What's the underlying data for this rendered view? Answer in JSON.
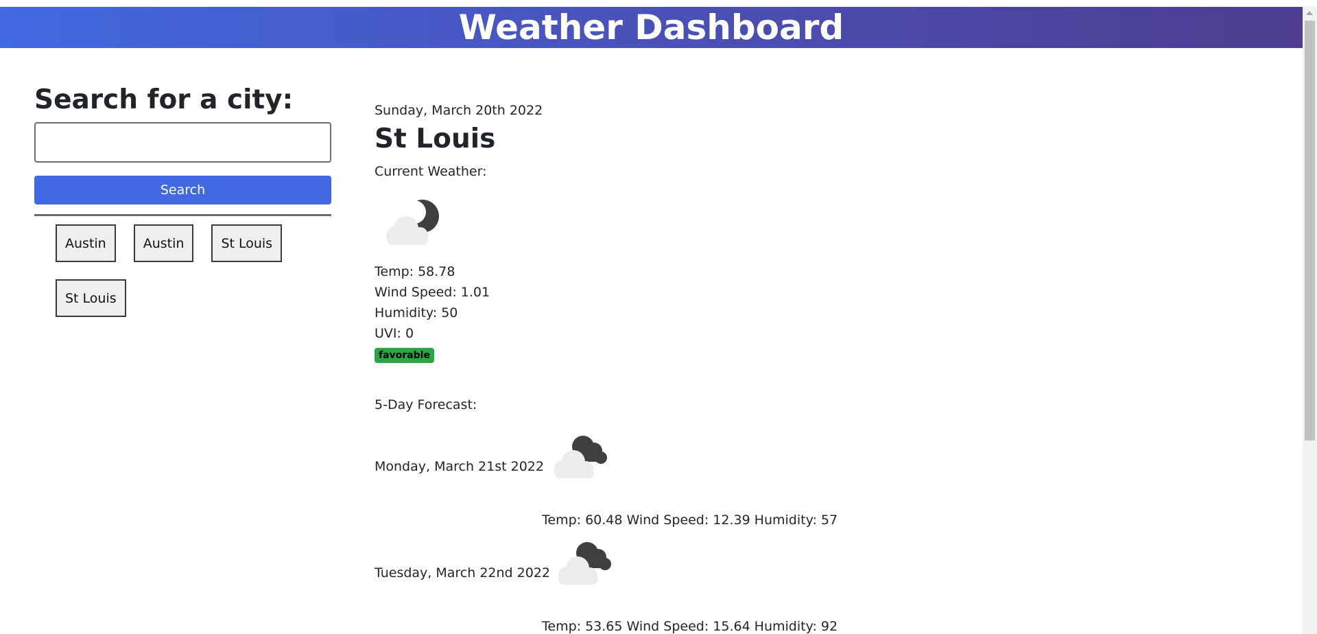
{
  "header": {
    "title": "Weather Dashboard"
  },
  "search": {
    "title": "Search for a city:",
    "input_value": "",
    "placeholder": "",
    "button_label": "Search"
  },
  "history": [
    "Austin",
    "Austin",
    "St Louis",
    "St Louis"
  ],
  "current": {
    "date": "Sunday, March 20th 2022",
    "city": "St Louis",
    "label": "Current Weather:",
    "icon": "cloud-with-moon-icon",
    "temp": "Temp: 58.78",
    "wind": "Wind Speed: 1.01",
    "humidity": "Humidity: 50",
    "uvi": "UVI: 0",
    "uvi_badge": "favorable",
    "badge_color": "#28a745"
  },
  "forecast": {
    "label": "5-Day Forecast:",
    "days": [
      {
        "date": "Monday, March 21st 2022",
        "icon": "broken-clouds-icon",
        "temp": "Temp: 60.48",
        "wind": "Wind Speed: 12.39",
        "humidity": "Humidity: 57"
      },
      {
        "date": "Tuesday, March 22nd 2022",
        "icon": "broken-clouds-icon",
        "temp": "Temp: 53.65",
        "wind": "Wind Speed: 15.64",
        "humidity": "Humidity: 92"
      }
    ]
  },
  "colors": {
    "header_start": "#4169e1",
    "header_end": "#4e3d8f",
    "search_button": "#4169e1"
  }
}
